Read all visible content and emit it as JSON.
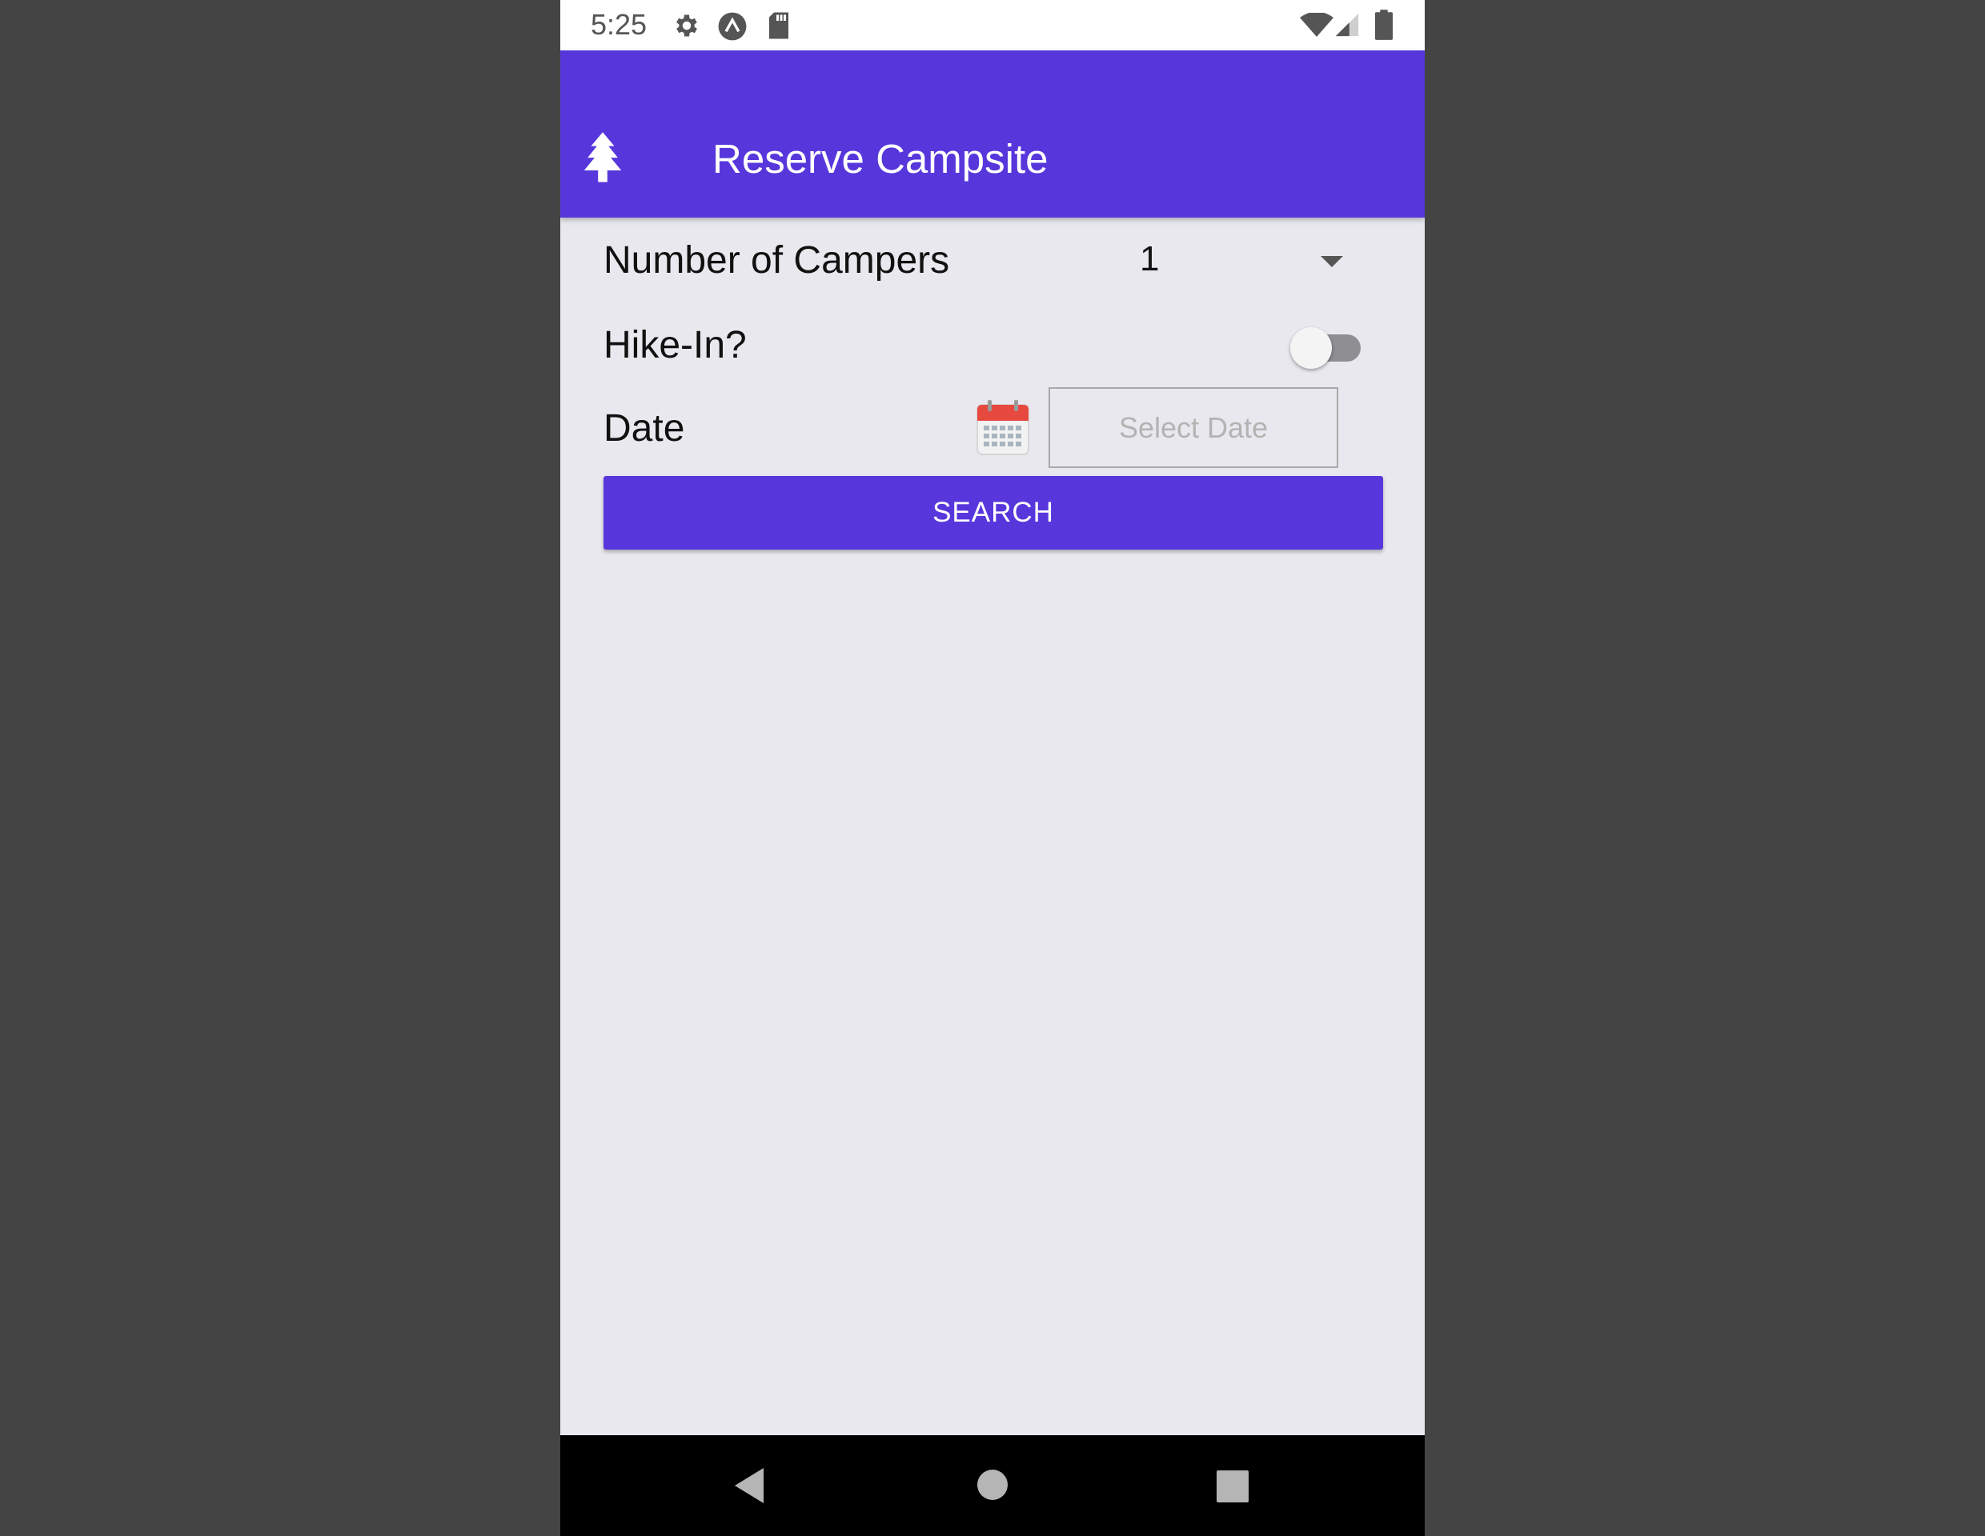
{
  "status_bar": {
    "time": "5:25",
    "left_icons": [
      "gear-icon",
      "expo-icon",
      "sd-card-icon"
    ],
    "right_icons": [
      "wifi-icon",
      "cell-signal-icon",
      "battery-icon"
    ]
  },
  "app_bar": {
    "title": "Reserve Campsite",
    "icon": "tree-icon",
    "color": "#5737dc"
  },
  "form": {
    "campers_label": "Number of Campers",
    "campers_value": "1",
    "hike_in_label": "Hike-In?",
    "hike_in_on": false,
    "date_label": "Date",
    "date_placeholder": "Select Date",
    "search_label": "SEARCH"
  },
  "nav_bar": {
    "buttons": [
      "back-icon",
      "home-icon",
      "recents-icon"
    ]
  }
}
